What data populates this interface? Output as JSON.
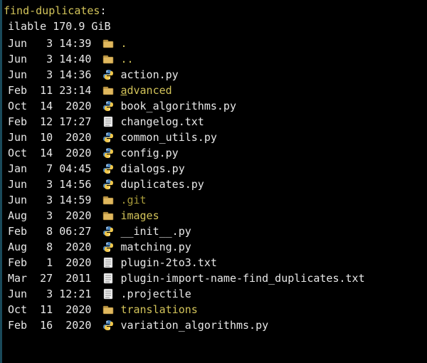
{
  "title": "find-duplicates",
  "title_colon": ":",
  "status": "ilable 170.9 GiB",
  "rows": [
    {
      "lead": " ",
      "date": "Jun   3 14:39",
      "icon": "folder",
      "name": ".",
      "cls": "dirname"
    },
    {
      "lead": " ",
      "date": "Jun   3 14:40",
      "icon": "folder",
      "name": "..",
      "cls": "dirname"
    },
    {
      "lead": " ",
      "date": "Jun   3 14:36",
      "icon": "python",
      "name": "action.py",
      "cls": "fname"
    },
    {
      "lead": " ",
      "date": "Feb  11 23:14",
      "icon": "folder",
      "name": "advanced",
      "cls": "dirname",
      "ul_first": true
    },
    {
      "lead": " ",
      "date": "Oct  14  2020",
      "icon": "python",
      "name": "book_algorithms.py",
      "cls": "fname"
    },
    {
      "lead": " ",
      "date": "Feb  12 17:27",
      "icon": "text",
      "name": "changelog.txt",
      "cls": "fname"
    },
    {
      "lead": " ",
      "date": "Jun  10  2020",
      "icon": "python",
      "name": "common_utils.py",
      "cls": "fname"
    },
    {
      "lead": " ",
      "date": "Oct  14  2020",
      "icon": "python",
      "name": "config.py",
      "cls": "fname"
    },
    {
      "lead": " ",
      "date": "Jan   7 04:45",
      "icon": "python",
      "name": "dialogs.py",
      "cls": "fname"
    },
    {
      "lead": " ",
      "date": "Jun   3 14:56",
      "icon": "python",
      "name": "duplicates.py",
      "cls": "fname"
    },
    {
      "lead": " ",
      "date": "Jun   3 14:59",
      "icon": "folder",
      "name": ".git",
      "cls": "dotdir"
    },
    {
      "lead": " ",
      "date": "Aug   3  2020",
      "icon": "folder",
      "name": "images",
      "cls": "dirname"
    },
    {
      "lead": " ",
      "date": "Feb   8 06:27",
      "icon": "python",
      "name": "__init__.py",
      "cls": "fname"
    },
    {
      "lead": " ",
      "date": "Aug   8  2020",
      "icon": "python",
      "name": "matching.py",
      "cls": "fname"
    },
    {
      "lead": " ",
      "date": "Feb   1  2020",
      "icon": "text",
      "name": "plugin-2to3.txt",
      "cls": "fname"
    },
    {
      "lead": " ",
      "date": "Mar  27  2011",
      "icon": "text",
      "name": "plugin-import-name-find_duplicates.txt",
      "cls": "fname"
    },
    {
      "lead": " ",
      "date": "Jun   3 12:21",
      "icon": "text",
      "name": ".projectile",
      "cls": "fname"
    },
    {
      "lead": " ",
      "date": "Oct  11  2020",
      "icon": "folder",
      "name": "translations",
      "cls": "dirname"
    },
    {
      "lead": " ",
      "date": "Feb  16  2020",
      "icon": "python",
      "name": "variation_algorithms.py",
      "cls": "fname"
    }
  ]
}
